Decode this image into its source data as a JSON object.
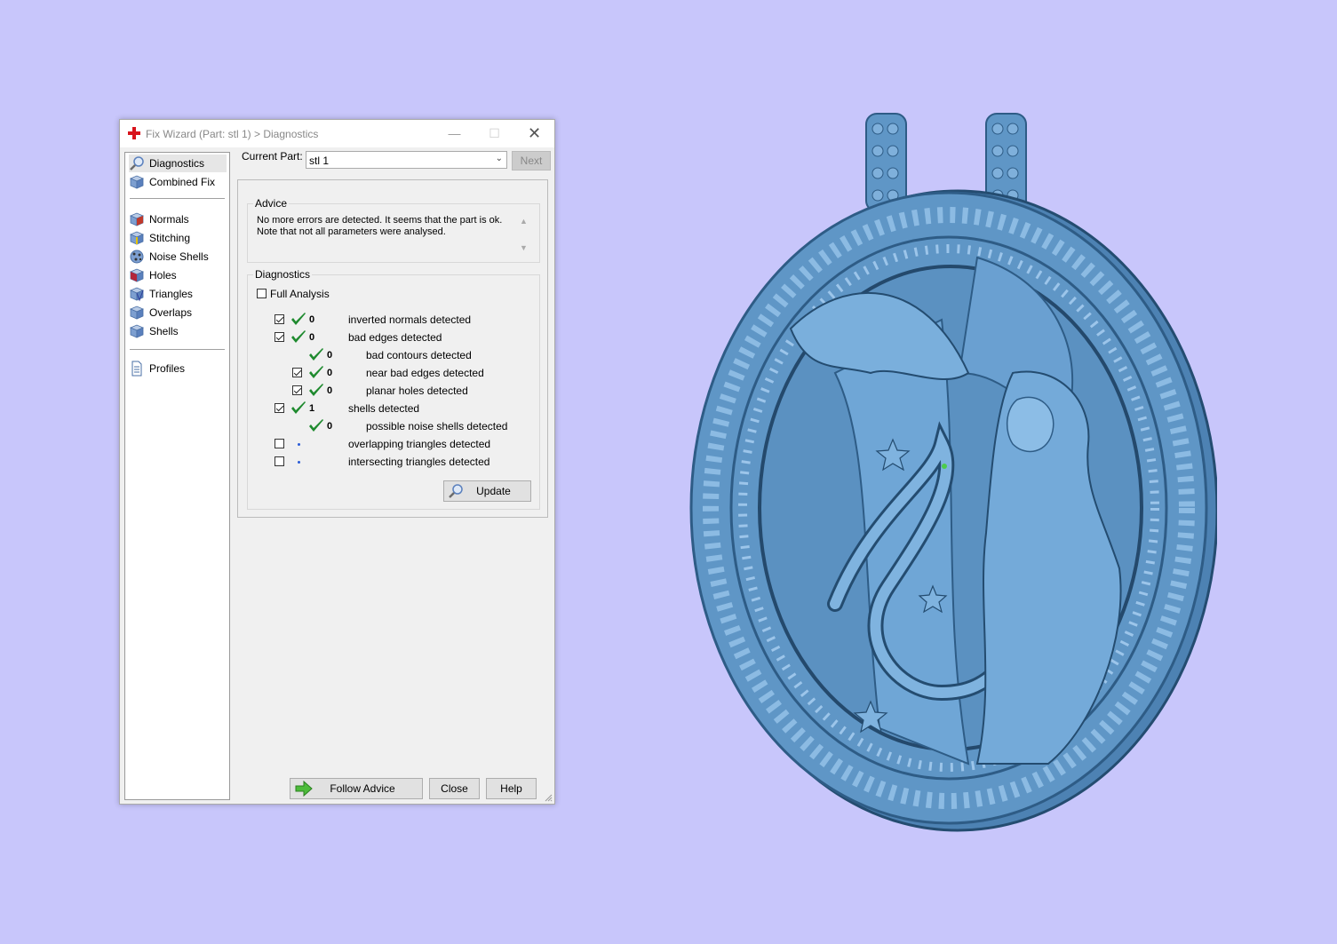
{
  "dialog": {
    "title": "Fix Wizard (Part: stl 1) > Diagnostics",
    "window_buttons": {
      "minimize": "—",
      "maximize": "☐",
      "close": "✕"
    }
  },
  "sidebar": {
    "items": [
      {
        "label": "Diagnostics",
        "icon": "magnifier-icon"
      },
      {
        "label": "Combined Fix",
        "icon": "cube-icon"
      },
      {
        "label": "Normals",
        "icon": "cube-normals-icon"
      },
      {
        "label": "Stitching",
        "icon": "cube-stitching-icon"
      },
      {
        "label": "Noise Shells",
        "icon": "noise-shells-icon"
      },
      {
        "label": "Holes",
        "icon": "cube-holes-icon"
      },
      {
        "label": "Triangles",
        "icon": "cube-triangles-icon"
      },
      {
        "label": "Overlaps",
        "icon": "cube-overlaps-icon"
      },
      {
        "label": "Shells",
        "icon": "cube-shells-icon"
      },
      {
        "label": "Profiles",
        "icon": "document-icon"
      }
    ]
  },
  "current_part": {
    "label": "Current Part:",
    "value": "stl 1",
    "next_label": "Next"
  },
  "advice": {
    "title": "Advice",
    "line1": "No more errors are detected. It seems that the part is ok.",
    "line2": "Note that not all parameters were analysed."
  },
  "diagnostics": {
    "title": "Diagnostics",
    "full_analysis": "Full Analysis",
    "rows": [
      {
        "count": "0",
        "label": "inverted normals detected"
      },
      {
        "count": "0",
        "label": "bad edges detected"
      },
      {
        "count": "0",
        "label": "bad contours detected"
      },
      {
        "count": "0",
        "label": "near bad edges detected"
      },
      {
        "count": "0",
        "label": "planar holes detected"
      },
      {
        "count": "1",
        "label": "shells detected"
      },
      {
        "count": "0",
        "label": "possible noise shells detected"
      },
      {
        "count": "",
        "label": "overlapping triangles detected"
      },
      {
        "count": "",
        "label": "intersecting triangles detected"
      }
    ],
    "update_label": "Update"
  },
  "footer": {
    "follow_advice": "Follow Advice",
    "close": "Close",
    "help": "Help"
  },
  "colors": {
    "background": "#c8c6fb",
    "model": "#5f96c6",
    "tick": "#1e8a2e"
  }
}
